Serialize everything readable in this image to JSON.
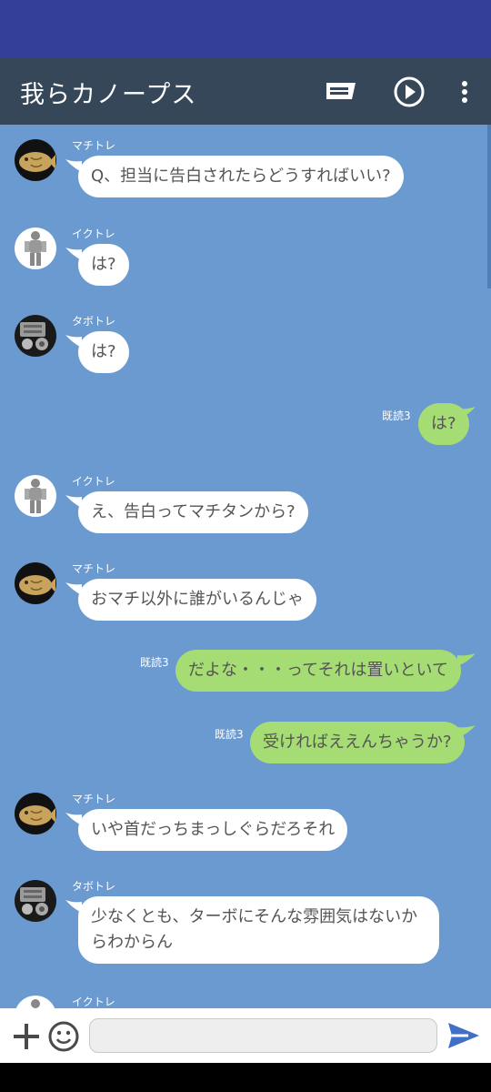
{
  "app": {
    "title": "我らカノープス"
  },
  "icons": {
    "notes": "message-icon",
    "play": "play-circle-icon",
    "menu": "more-vert-icon",
    "add": "plus-icon",
    "emoji": "emoji-icon",
    "send": "send-icon"
  },
  "colors": {
    "status_bar": "#343f9a",
    "app_bar": "#354758",
    "chat_bg": "#6a9ad0",
    "bubble_in": "#ffffff",
    "bubble_out": "#a6dc74",
    "send": "#3f6fc6"
  },
  "messages": [
    {
      "sender": "マチトレ",
      "text": "Q、担当に告白されたらどうすればいい?"
    },
    {
      "sender": "イクトレ",
      "text": "は?"
    },
    {
      "sender": "タボトレ",
      "text": "は?"
    },
    {
      "read": "既読3",
      "text": "は?"
    },
    {
      "sender": "イクトレ",
      "text": "え、告白ってマチタンから?"
    },
    {
      "sender": "マチトレ",
      "text": "おマチ以外に誰がいるんじゃ"
    },
    {
      "read": "既読3",
      "text": "だよな・・・ってそれは置いといて"
    },
    {
      "read": "既読3",
      "text": "受ければええんちゃうか?"
    },
    {
      "sender": "マチトレ",
      "text": "いや首だっちまっしぐらだろそれ"
    },
    {
      "sender": "タボトレ",
      "text": "少なくとも、ターボにそんな雰囲気はないからわからん"
    },
    {
      "sender": "イクトレ",
      "text": ""
    }
  ],
  "input": {
    "placeholder": ""
  }
}
